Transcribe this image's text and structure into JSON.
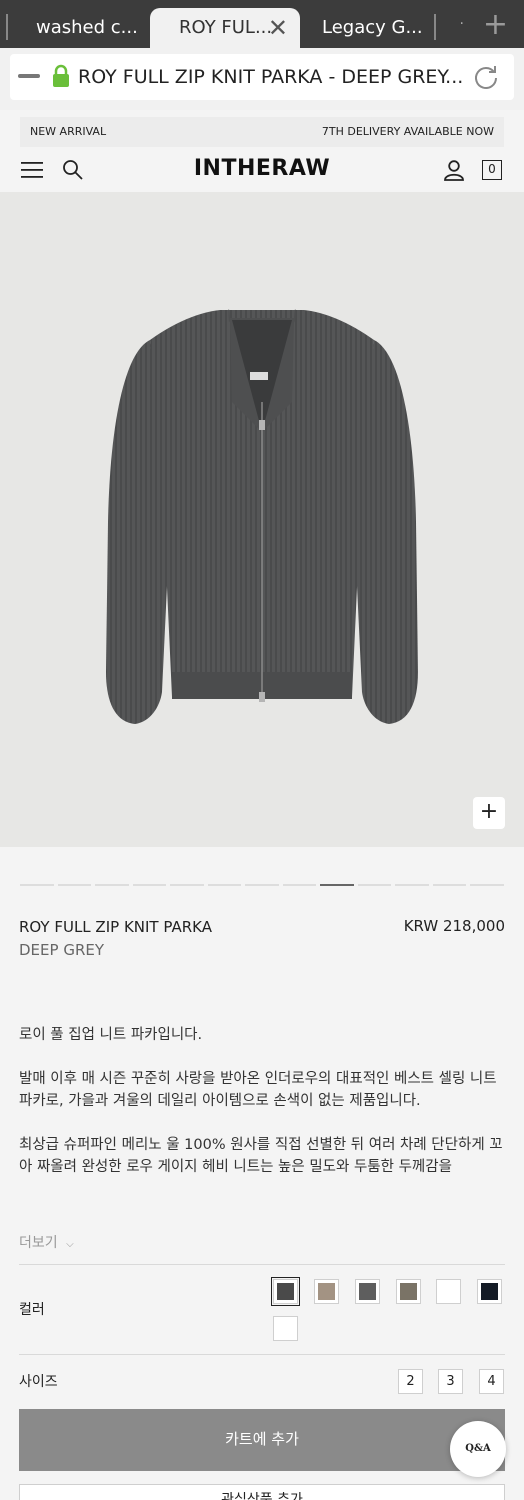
{
  "browser": {
    "tabs": [
      {
        "title": "washed c..."
      },
      {
        "title": "ROY FUL..."
      },
      {
        "title": "Legacy G..."
      }
    ],
    "address": "ROY FULL ZIP KNIT PARKA - DEEP GREY..."
  },
  "site": {
    "notice_left": "NEW ARRIVAL",
    "notice_right": "7TH DELIVERY AVAILABLE NOW",
    "logo": "INTHERAW",
    "cart_count": "0"
  },
  "gallery": {
    "zoom_label": "+",
    "total_images": 13,
    "current_index": 9
  },
  "product": {
    "name": "ROY FULL ZIP KNIT PARKA",
    "color": "DEEP GREY",
    "price": "KRW 218,000",
    "description": [
      "로이 풀 집업 니트 파카입니다.",
      "발매 이후 매 시즌 꾸준히 사랑을 받아온 인더로우의 대표적인 베스트 셀링 니트 파카로, 가을과 겨울의 데일리 아이템으로 손색이 없는 제품입니다.",
      "최상급 슈퍼파인 메리노 울 100% 원사를 직접 선별한 뒤 여러 차례 단단하게 꼬아 짜올려 완성한 로우 게이지 헤비 니트는 높은 밀도와 두툼한 두께감을"
    ],
    "more_label": "더보기",
    "color_label": "컬러",
    "swatches": [
      "#4a4a4a",
      "#a39383",
      "#5e5e5e",
      "#7a7366",
      "#ffffff",
      "#141b26",
      "#ffffff"
    ],
    "selected_swatch": 0,
    "size_label": "사이즈",
    "sizes": [
      "2",
      "3",
      "4"
    ],
    "cart_button": "카트에 추가",
    "wishlist_button": "관심상품 추가",
    "qa_label": "Q&A"
  },
  "colors": {
    "tabstrip": "#3c3c3c",
    "cart_button": "#8a8a8a",
    "lock_green": "#6abf3a"
  }
}
